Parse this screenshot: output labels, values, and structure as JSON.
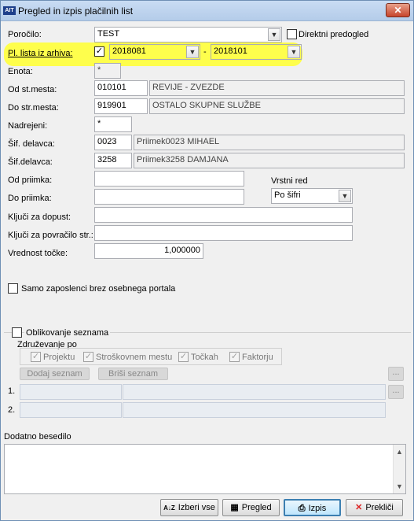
{
  "window": {
    "title": "Pregled in izpis plačilnih list",
    "app_icon_text": "AIT",
    "close_label": "✕"
  },
  "porocilo": {
    "label": "Poročilo:",
    "value": "TEST"
  },
  "direktni": {
    "label": "Direktni predogled",
    "checked": false
  },
  "arhiv": {
    "label": "Pl. lista iz arhiva:",
    "checkbox": "✓",
    "from": "2018081",
    "separator": "-",
    "to": "2018101"
  },
  "enota": {
    "label": "Enota:",
    "value": "*"
  },
  "od_st_mesta": {
    "label": "Od st.mesta:",
    "code": "010101",
    "name": "REVIJE - ZVEZDE"
  },
  "do_str_mesta": {
    "label": "Do str.mesta:",
    "code": "919901",
    "name": "OSTALO SKUPNE SLUŽBE"
  },
  "nadrejeni": {
    "label": "Nadrejeni:",
    "value": "*"
  },
  "sif_delavca_1": {
    "label": "Šif. delavca:",
    "code": "0023",
    "name": "Priimek0023  MIHAEL"
  },
  "sif_delavca_2": {
    "label": "Šif.delavca:",
    "code": "3258",
    "name": "Priimek3258  DAMJANA"
  },
  "od_priimka": {
    "label": "Od priimka:",
    "value": ""
  },
  "do_priimka": {
    "label": "Do priimka:",
    "value": ""
  },
  "vrstni_red": {
    "label": "Vrstni red",
    "value": "Po šifri"
  },
  "kljuci_dopust": {
    "label": "Ključi za dopust:",
    "value": ""
  },
  "kljuci_povracilo": {
    "label": "Ključi za povračilo str.:",
    "value": ""
  },
  "vrednost_tocke": {
    "label": "Vrednost točke:",
    "value": "1,000000"
  },
  "samo_zaposleni": {
    "label": "Samo zaposlenci brez osebnega portala"
  },
  "oblikovanje": {
    "label": "Oblikovanje seznama",
    "zdruzevanje_label": "Združevanje po",
    "options": [
      "Projektu",
      "Stroškovnem mestu",
      "Točkah",
      "Faktorju"
    ],
    "check_mark": "✓",
    "dodaj": "Dodaj seznam",
    "brisi": "Briši seznam",
    "row1": "1.",
    "row2": "2.",
    "ellipsis": "..."
  },
  "dodatno": {
    "label": "Dodatno besedilo",
    "value": ""
  },
  "buttons": {
    "izberi": "Izberi vse",
    "pregled": "Pregled",
    "izpis": "Izpis",
    "preklici": "Prekliči",
    "sort_icon": "A↓Z",
    "cancel_icon": "✕"
  },
  "colors": {
    "highlight": "#ffff3a",
    "title_bar": "#b4cce9"
  }
}
